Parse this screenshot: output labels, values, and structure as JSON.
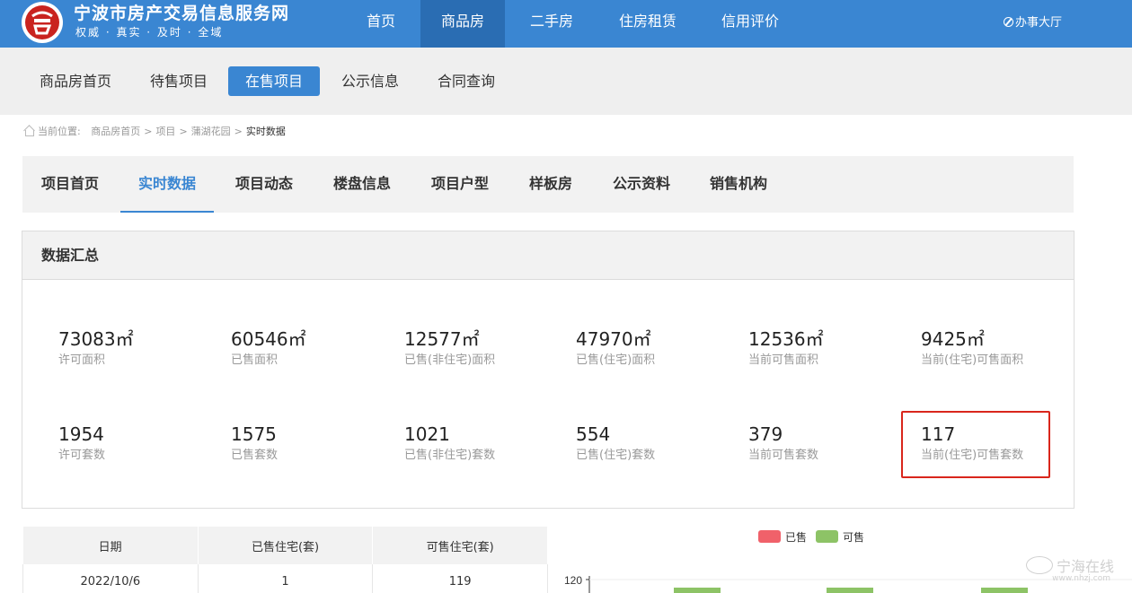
{
  "site": {
    "title": "宁波市房产交易信息服务网",
    "slogan": "权威 · 真实 · 及时 · 全域"
  },
  "main_nav": [
    {
      "label": "首页"
    },
    {
      "label": "商品房"
    },
    {
      "label": "二手房"
    },
    {
      "label": "住房租赁"
    },
    {
      "label": "信用评价"
    }
  ],
  "office_link": "办事大厅",
  "sub_nav": [
    {
      "label": "商品房首页"
    },
    {
      "label": "待售项目"
    },
    {
      "label": "在售项目"
    },
    {
      "label": "公示信息"
    },
    {
      "label": "合同查询"
    }
  ],
  "breadcrumb": {
    "prefix": "当前位置:",
    "items": [
      "商品房首页",
      "项目",
      "蒲湖花园"
    ],
    "current": "实时数据",
    "separator": ">"
  },
  "project_tabs": [
    {
      "label": "项目首页"
    },
    {
      "label": "实时数据"
    },
    {
      "label": "项目动态"
    },
    {
      "label": "楼盘信息"
    },
    {
      "label": "项目户型"
    },
    {
      "label": "样板房"
    },
    {
      "label": "公示资料"
    },
    {
      "label": "销售机构"
    }
  ],
  "summary": {
    "title": "数据汇总",
    "area_stats": [
      {
        "value": "73083㎡",
        "label": "许可面积"
      },
      {
        "value": "60546㎡",
        "label": "已售面积"
      },
      {
        "value": "12577㎡",
        "label": "已售(非住宅)面积"
      },
      {
        "value": "47970㎡",
        "label": "已售(住宅)面积"
      },
      {
        "value": "12536㎡",
        "label": "当前可售面积"
      },
      {
        "value": "9425㎡",
        "label": "当前(住宅)可售面积"
      }
    ],
    "count_stats": [
      {
        "value": "1954",
        "label": "许可套数"
      },
      {
        "value": "1575",
        "label": "已售套数"
      },
      {
        "value": "1021",
        "label": "已售(非住宅)套数"
      },
      {
        "value": "554",
        "label": "已售(住宅)套数"
      },
      {
        "value": "379",
        "label": "当前可售套数"
      },
      {
        "value": "117",
        "label": "当前(住宅)可售套数"
      }
    ],
    "highlight_color": "#d9261c"
  },
  "daily_table": {
    "headers": [
      "日期",
      "已售住宅(套)",
      "可售住宅(套)"
    ],
    "rows": [
      [
        "2022/10/6",
        "1",
        "119"
      ]
    ]
  },
  "chart_data": {
    "type": "bar",
    "series": [
      {
        "name": "已售",
        "color": "#f0616a",
        "values": []
      },
      {
        "name": "可售",
        "color": "#8dc366",
        "values": [
          119
        ]
      }
    ],
    "ytick_top": "120",
    "legend_position": "top-center"
  },
  "watermark": {
    "text": "宁海在线",
    "sub": "www.nhzj.com"
  },
  "colors": {
    "header_blue": "#3a86d2",
    "header_active": "#2a6db3",
    "panel_gray": "#f2f2f2"
  }
}
